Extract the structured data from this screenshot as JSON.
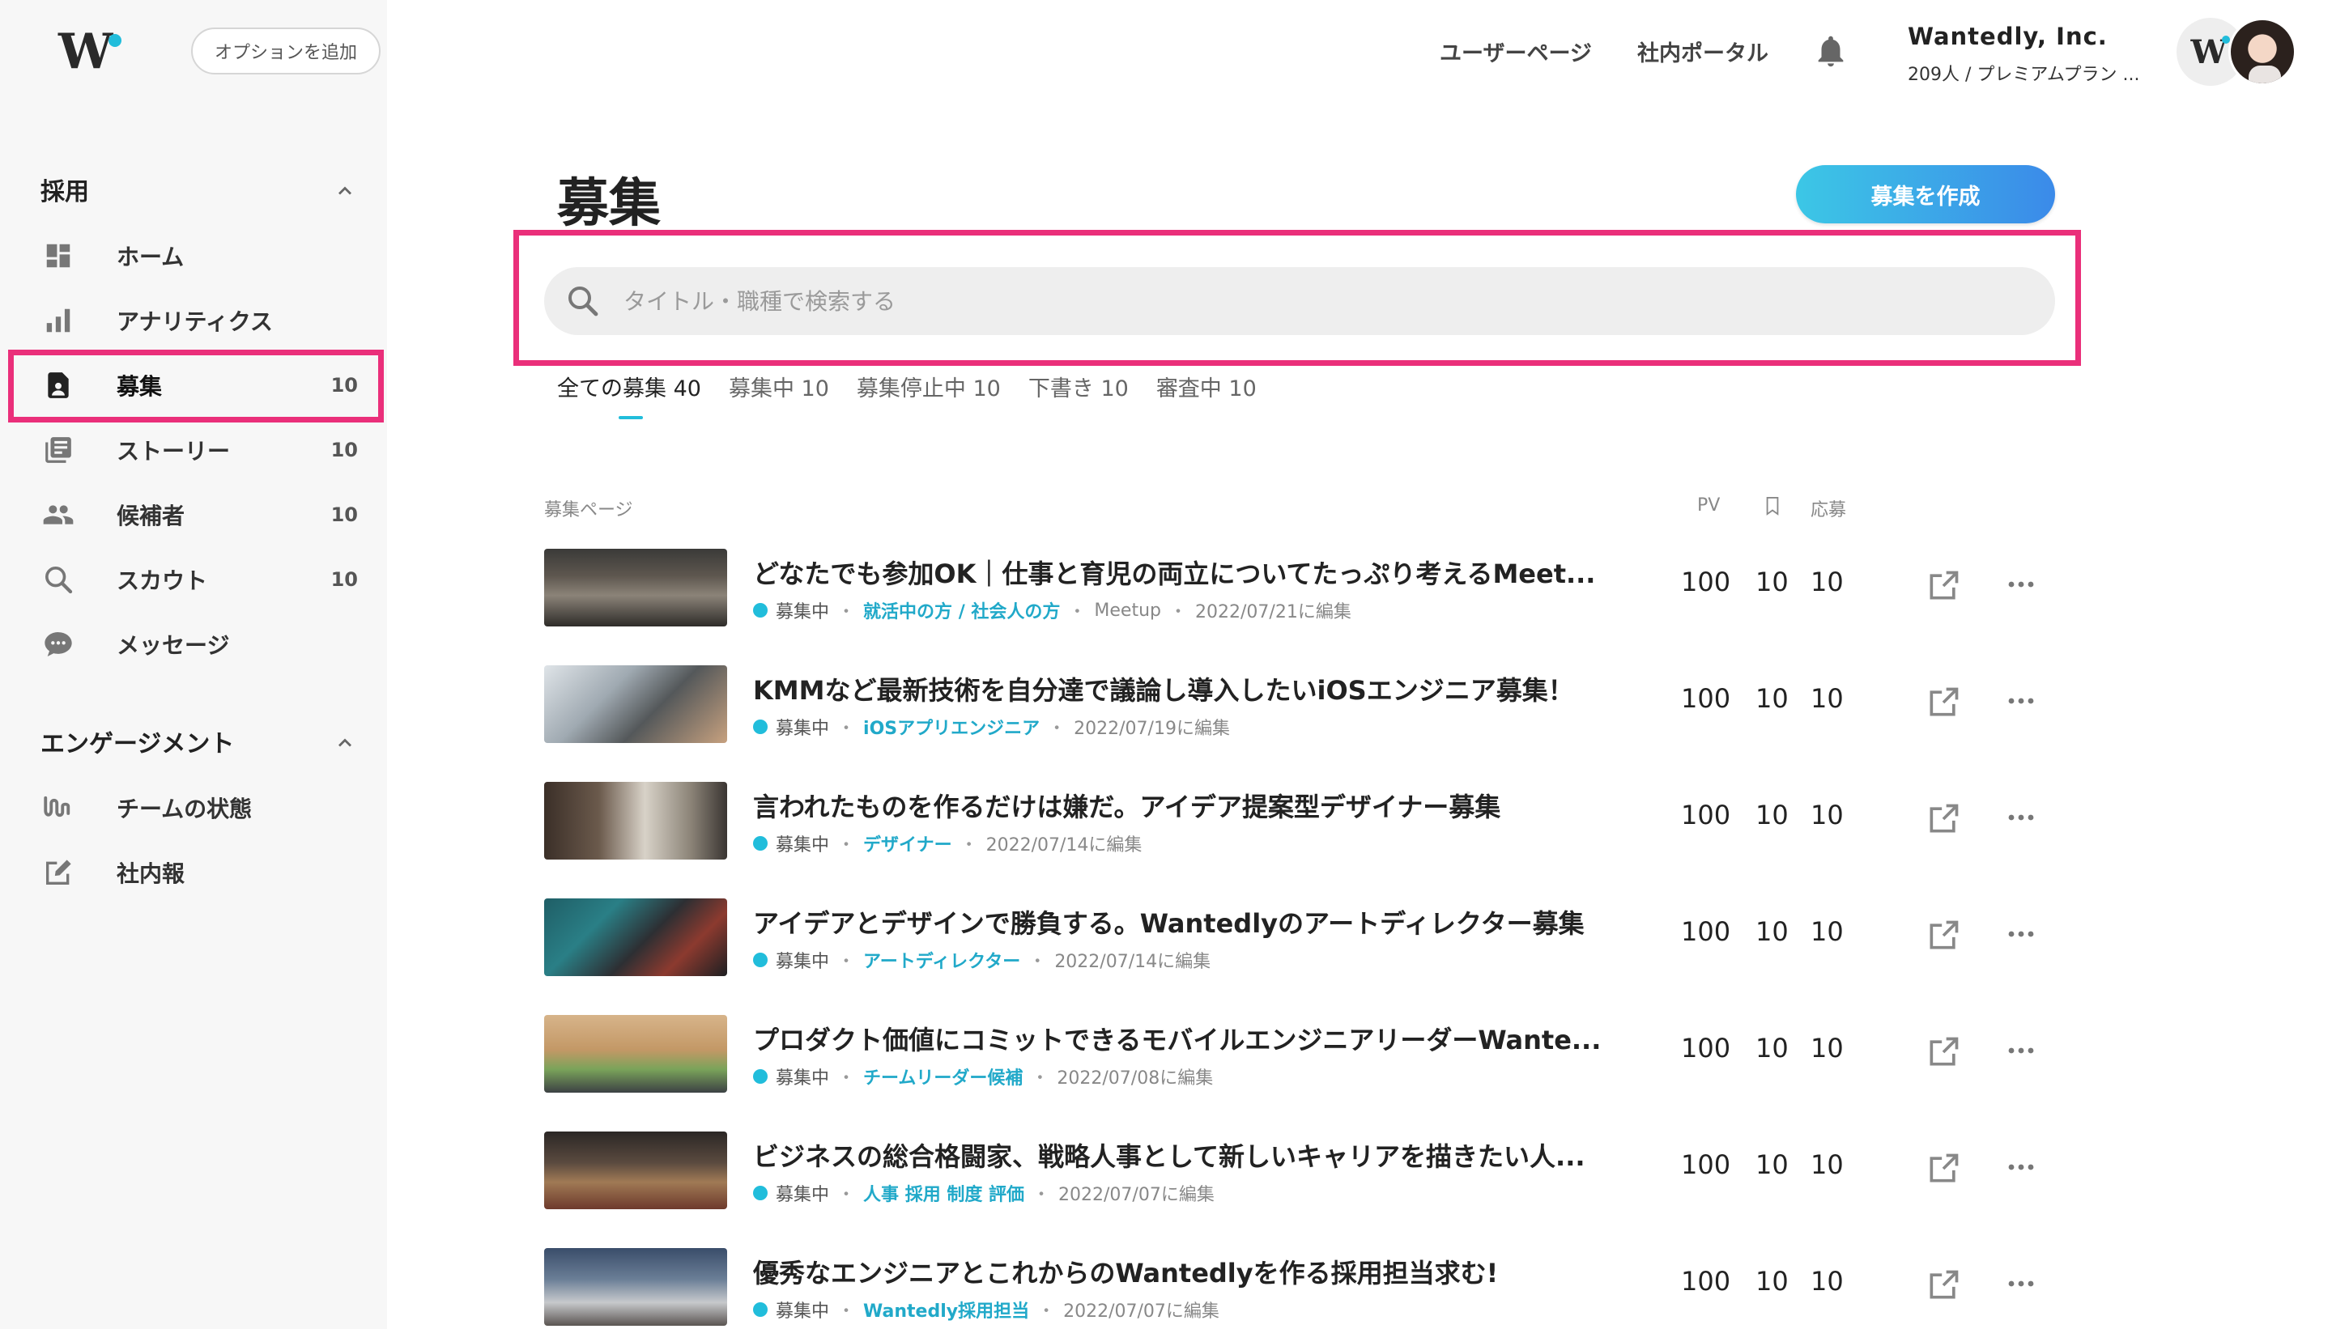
{
  "header": {
    "logo": "W",
    "option_button": "オプションを追加",
    "links": [
      "ユーザーページ",
      "社内ポータル"
    ],
    "company": {
      "name": "Wantedly, Inc.",
      "sub": "209人 / プレミアムプラン ..."
    }
  },
  "sidebar": {
    "sections": [
      {
        "title": "採用",
        "items": [
          {
            "label": "ホーム",
            "count": "",
            "icon": "dashboard-icon"
          },
          {
            "label": "アナリティクス",
            "count": "",
            "icon": "analytics-icon"
          },
          {
            "label": "募集",
            "count": "10",
            "icon": "recruit-icon",
            "active": true
          },
          {
            "label": "ストーリー",
            "count": "10",
            "icon": "story-icon"
          },
          {
            "label": "候補者",
            "count": "10",
            "icon": "candidates-icon"
          },
          {
            "label": "スカウト",
            "count": "10",
            "icon": "search-icon"
          },
          {
            "label": "メッセージ",
            "count": "",
            "icon": "message-icon"
          }
        ]
      },
      {
        "title": "エンゲージメント",
        "items": [
          {
            "label": "チームの状態",
            "count": "",
            "icon": "team-state-icon"
          },
          {
            "label": "社内報",
            "count": "",
            "icon": "internal-news-icon"
          }
        ]
      }
    ]
  },
  "main": {
    "title": "募集",
    "create_button": "募集を作成",
    "search": {
      "placeholder": "タイトル・職種で検索する",
      "value": ""
    },
    "tabs": [
      "全ての募集 40",
      "募集中 10",
      "募集停止中 10",
      "下書き 10",
      "審査中 10"
    ],
    "columns": {
      "page": "募集ページ",
      "pv": "PV",
      "apply": "応募"
    },
    "rows": [
      {
        "title": "どなたでも参加OK｜仕事と育児の両立についてたっぷり考えるMeet...",
        "status": "募集中",
        "tag": "就活中の方 / 社会人の方",
        "extra": "Meetup",
        "date": "2022/07/21に編集",
        "pv": "100",
        "bookmarks": "10",
        "applies": "10"
      },
      {
        "title": "KMMなど最新技術を自分達で議論し導入したいiOSエンジニア募集！",
        "status": "募集中",
        "tag": "iOSアプリエンジニア",
        "extra": "",
        "date": "2022/07/19に編集",
        "pv": "100",
        "bookmarks": "10",
        "applies": "10"
      },
      {
        "title": "言われたものを作るだけは嫌だ。アイデア提案型デザイナー募集",
        "status": "募集中",
        "tag": "デザイナー",
        "extra": "",
        "date": "2022/07/14に編集",
        "pv": "100",
        "bookmarks": "10",
        "applies": "10"
      },
      {
        "title": "アイデアとデザインで勝負する。Wantedlyのアートディレクター募集",
        "status": "募集中",
        "tag": "アートディレクター",
        "extra": "",
        "date": "2022/07/14に編集",
        "pv": "100",
        "bookmarks": "10",
        "applies": "10"
      },
      {
        "title": "プロダクト価値にコミットできるモバイルエンジニアリーダーWante...",
        "status": "募集中",
        "tag": "チームリーダー候補",
        "extra": "",
        "date": "2022/07/08に編集",
        "pv": "100",
        "bookmarks": "10",
        "applies": "10"
      },
      {
        "title": "ビジネスの総合格闘家、戦略人事として新しいキャリアを描きたい人...",
        "status": "募集中",
        "tag": "人事 採用 制度 評価",
        "extra": "",
        "date": "2022/07/07に編集",
        "pv": "100",
        "bookmarks": "10",
        "applies": "10"
      },
      {
        "title": "優秀なエンジニアとこれからのWantedlyを作る採用担当求む!",
        "status": "募集中",
        "tag": "Wantedly採用担当",
        "extra": "",
        "date": "2022/07/07に編集",
        "pv": "100",
        "bookmarks": "10",
        "applies": "10"
      }
    ]
  },
  "colors": {
    "accent": "#21bddb",
    "highlight": "#ea2f7a",
    "button_start": "#3cc7e6",
    "button_end": "#3b8ae9"
  }
}
